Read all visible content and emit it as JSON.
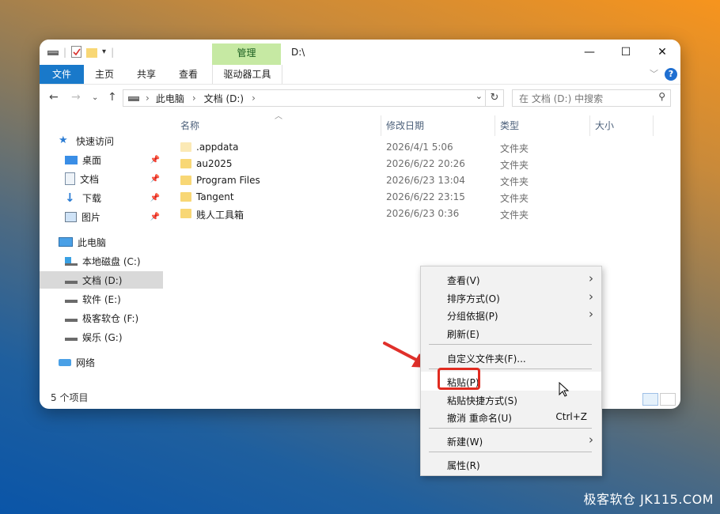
{
  "titlebar": {
    "manage_tab": "管理",
    "path_title": "D:\\",
    "minimize": "—",
    "maximize": "☐",
    "close": "✕"
  },
  "ribbon": {
    "tabs": [
      "文件",
      "主页",
      "共享",
      "查看",
      "驱动器工具"
    ],
    "help": "?"
  },
  "address": {
    "crumbs": [
      "此电脑",
      "文档 (D:)"
    ],
    "search_placeholder": "在 文档 (D:) 中搜索"
  },
  "sidebar": {
    "quick_access": "快速访问",
    "quick_items": [
      "桌面",
      "文档",
      "下载",
      "图片"
    ],
    "this_pc": "此电脑",
    "drives": [
      "本地磁盘 (C:)",
      "文档 (D:)",
      "软件 (E:)",
      "极客软仓 (F:)",
      "娱乐 (G:)"
    ],
    "network": "网络",
    "selected": "文档 (D:)"
  },
  "columns": {
    "name": "名称",
    "modified": "修改日期",
    "type": "类型",
    "size": "大小"
  },
  "files": [
    {
      "name": ".appdata",
      "modified": "2026/4/1 5:06",
      "type": "文件夹"
    },
    {
      "name": "au2025",
      "modified": "2026/6/22 20:26",
      "type": "文件夹"
    },
    {
      "name": "Program Files",
      "modified": "2026/6/23 13:04",
      "type": "文件夹"
    },
    {
      "name": "Tangent",
      "modified": "2026/6/22 23:15",
      "type": "文件夹"
    },
    {
      "name": "贱人工具箱",
      "modified": "2026/6/23 0:36",
      "type": "文件夹"
    }
  ],
  "status": "5 个项目",
  "context_menu": {
    "view": "查看(V)",
    "sort": "排序方式(O)",
    "group": "分组依据(P)",
    "refresh": "刷新(E)",
    "customize": "自定义文件夹(F)...",
    "paste": "粘贴(P)",
    "paste_shortcut": "粘贴快捷方式(S)",
    "undo": "撤消 重命名(U)",
    "undo_shortcut": "Ctrl+Z",
    "new": "新建(W)",
    "properties": "属性(R)"
  },
  "watermark": "极客软仓 JK115.COM",
  "colors": {
    "file_tab": "#1979ca",
    "manage_tab": "#c6e9a3",
    "highlight_box": "#e02b20",
    "arrow": "#e0302a"
  }
}
